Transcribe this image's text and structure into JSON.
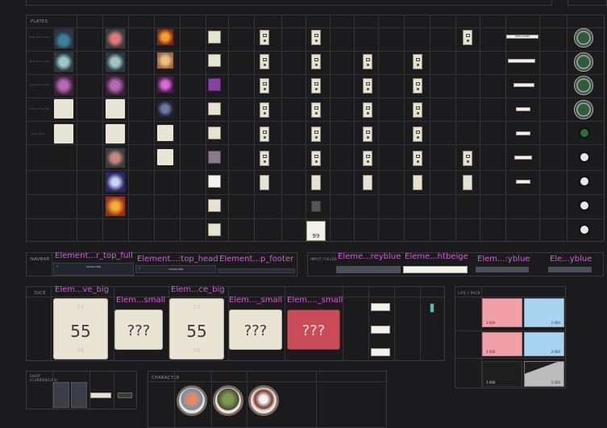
{
  "plates": {
    "title": "PLATES",
    "row_labels": [
      "plate_frame_item",
      "plate_frame_item",
      "plate_frame_item",
      "plate_frame_item",
      "plate_blank"
    ],
    "bar_labels": [
      "HERO NAME",
      "",
      "",
      "",
      "",
      "",
      ""
    ]
  },
  "navbar": {
    "title": "NAVBAR",
    "header_label": "CHARACTER",
    "labels": [
      "Element...r_top_full",
      "Element...:top_head",
      "Element...p_footer"
    ]
  },
  "input_fields": {
    "title": "INPUT FIELDS",
    "labels": [
      "Eleme...reyblue",
      "Eleme...htbeige",
      "Elem...:yblue",
      "Ele...yblue"
    ]
  },
  "dice": {
    "title": "DICE",
    "labels": [
      "Elem...ve_big",
      "Elem...small",
      "Elem...ce_big",
      "Elem..._small",
      "Elem...._small"
    ],
    "values": [
      "55",
      "???",
      "55",
      "???",
      "???"
    ],
    "ghost_top": [
      "54",
      "54"
    ],
    "ghost_bottom": [
      "56",
      "56"
    ]
  },
  "life_pack": {
    "title": "LIFE / PACK",
    "values": [
      "3 000",
      "3 000",
      "3 000",
      "3 000",
      "3 000",
      "3 000"
    ]
  },
  "shop": {
    "title": "SHOP\n(CURRENCIES)"
  },
  "character": {
    "title": "CHARACTER"
  },
  "card_values": {
    "hero_card": "99"
  },
  "colors": {
    "background": "#1b1b1d",
    "pink_label": "#d65ad9",
    "life_red": "#f2a0a8",
    "life_blue": "#a9d4ef",
    "dice_red": "#c94b57"
  }
}
